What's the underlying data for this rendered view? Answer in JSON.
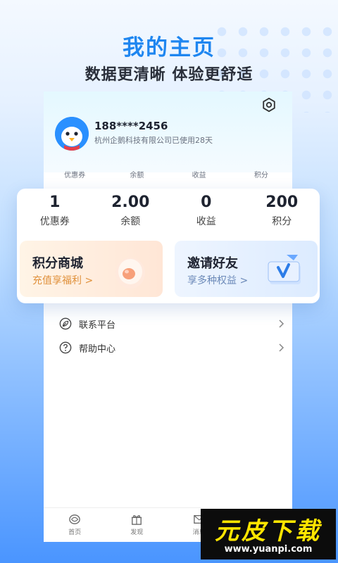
{
  "hero": {
    "title": "我的主页",
    "subtitle": "数据更清晰 体验更舒适"
  },
  "profile": {
    "phone": "188****2456",
    "org": "杭州企鹅科技有限公司已使用28天",
    "avatar_icon": "penguin-avatar",
    "settings_icon": "gear-icon"
  },
  "mini_stats": [
    "优惠券",
    "余额",
    "收益",
    "积分"
  ],
  "stats": [
    {
      "value": "1",
      "label": "优惠券"
    },
    {
      "value": "2.00",
      "label": "余额"
    },
    {
      "value": "0",
      "label": "收益"
    },
    {
      "value": "200",
      "label": "积分"
    }
  ],
  "promos": {
    "points_mall": {
      "title": "积分商城",
      "subtitle": "充值享福利 >",
      "icon": "egg-icon"
    },
    "invite": {
      "title": "邀请好友",
      "subtitle": "享多种权益 >",
      "icon": "v-card-icon"
    }
  },
  "menu": [
    {
      "label": "联系平台",
      "icon": "leaf-icon"
    },
    {
      "label": "帮助中心",
      "icon": "help-icon"
    }
  ],
  "tabbar": [
    {
      "label": "首页",
      "icon": "home-icon"
    },
    {
      "label": "发现",
      "icon": "gift-icon"
    },
    {
      "label": "消息",
      "icon": "mail-icon"
    }
  ],
  "watermark": {
    "title": "元皮下载",
    "url": "www.yuanpi.com"
  },
  "colors": {
    "accent": "#1f86f0",
    "promo_orange": "#e0913c",
    "watermark_yellow": "#ffe500"
  }
}
